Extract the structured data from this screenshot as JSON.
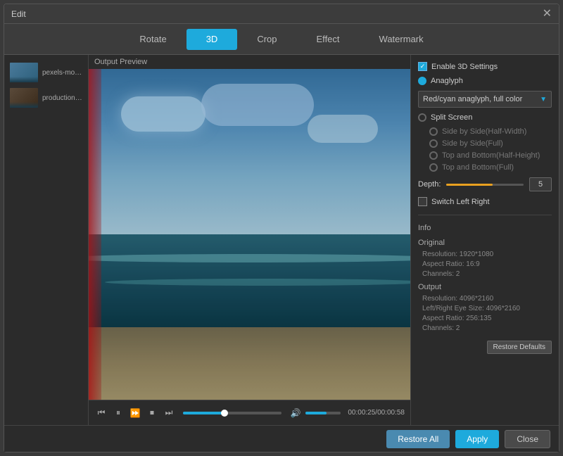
{
  "window": {
    "title": "Edit"
  },
  "tabs": [
    {
      "id": "rotate",
      "label": "Rotate",
      "active": false
    },
    {
      "id": "3d",
      "label": "3D",
      "active": true
    },
    {
      "id": "crop",
      "label": "Crop",
      "active": false
    },
    {
      "id": "effect",
      "label": "Effect",
      "active": false
    },
    {
      "id": "watermark",
      "label": "Watermark",
      "active": false
    }
  ],
  "sidebar": {
    "items": [
      {
        "label": "pexels-movie..."
      },
      {
        "label": "production_id..."
      }
    ]
  },
  "preview": {
    "label": "Output Preview"
  },
  "controls": {
    "time": "00:00:25/00:00:58"
  },
  "panel": {
    "enable_3d_label": "Enable 3D Settings",
    "anaglyph_label": "Anaglyph",
    "dropdown_value": "Red/cyan anaglyph, full color",
    "split_screen_label": "Split Screen",
    "side_by_side_half_label": "Side by Side(Half-Width)",
    "side_by_side_full_label": "Side by Side(Full)",
    "top_bottom_half_label": "Top and Bottom(Half-Height)",
    "top_bottom_full_label": "Top and Bottom(Full)",
    "depth_label": "Depth:",
    "depth_value": "5",
    "switch_lr_label": "Switch Left Right",
    "info_label": "Info",
    "original_label": "Original",
    "orig_resolution": "Resolution: 1920*1080",
    "orig_aspect": "Aspect Ratio: 16:9",
    "orig_channels": "Channels: 2",
    "output_label": "Output",
    "out_resolution": "Resolution: 4096*2160",
    "out_lr_size": "Left/Right Eye Size: 4096*2160",
    "out_aspect": "Aspect Ratio: 256:135",
    "out_channels": "Channels: 2",
    "restore_defaults_label": "Restore Defaults"
  },
  "bottom_bar": {
    "restore_all_label": "Restore All",
    "apply_label": "Apply",
    "close_label": "Close"
  }
}
